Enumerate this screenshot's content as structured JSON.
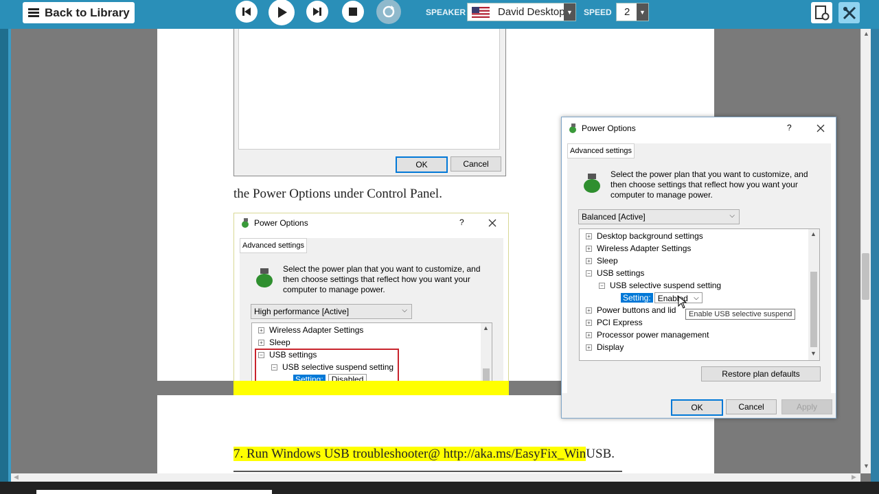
{
  "toolbar": {
    "back_label": "Back to Library",
    "speaker_label": "SPEAKER",
    "speaker_value": "David Desktop",
    "speed_label": "SPEED",
    "speed_value": "2"
  },
  "doc": {
    "line1": "the Power Options under Control Panel.",
    "step7_highlight": "7. Run Windows USB troubleshooter@ http://aka.ms/EasyFix_Win",
    "step7_rest": "USB."
  },
  "dialog_top": {
    "ok": "OK",
    "cancel": "Cancel"
  },
  "dialog_small": {
    "title": "Power Options",
    "help": "?",
    "tab": "Advanced settings",
    "description": "Select the power plan that you want to customize, and then choose settings that reflect how you want your computer to manage power.",
    "plan": "High performance [Active]",
    "tree": [
      {
        "sign": "+",
        "label": "Wireless Adapter Settings"
      },
      {
        "sign": "+",
        "label": "Sleep"
      },
      {
        "sign": "−",
        "label": "USB settings"
      },
      {
        "sign": "−",
        "label": "USB selective suspend setting"
      }
    ],
    "setting_label": "Setting:",
    "setting_value": "Disabled"
  },
  "dialog_large": {
    "title": "Power Options",
    "help": "?",
    "tab": "Advanced settings",
    "description": "Select the power plan that you want to customize, and then choose settings that reflect how you want your computer to manage power.",
    "plan": "Balanced [Active]",
    "tree": [
      {
        "sign": "+",
        "label": "Desktop background settings"
      },
      {
        "sign": "+",
        "label": "Wireless Adapter Settings"
      },
      {
        "sign": "+",
        "label": "Sleep"
      },
      {
        "sign": "−",
        "label": "USB settings"
      },
      {
        "sign": "−",
        "label": "USB selective suspend setting"
      },
      {
        "sign": "",
        "label": ""
      },
      {
        "sign": "+",
        "label": "Power buttons and lid"
      },
      {
        "sign": "+",
        "label": "PCI Express"
      },
      {
        "sign": "+",
        "label": "Processor power management"
      },
      {
        "sign": "+",
        "label": "Display"
      }
    ],
    "setting_label": "Setting:",
    "setting_value": "Enabled",
    "tooltip": "Enable USB selective suspend",
    "restore": "Restore plan defaults",
    "ok": "OK",
    "cancel": "Cancel",
    "apply": "Apply"
  },
  "colors": {
    "toolbar": "#2a8fb8",
    "highlight_yellow": "#ffff00",
    "windows_blue": "#0078d7"
  }
}
